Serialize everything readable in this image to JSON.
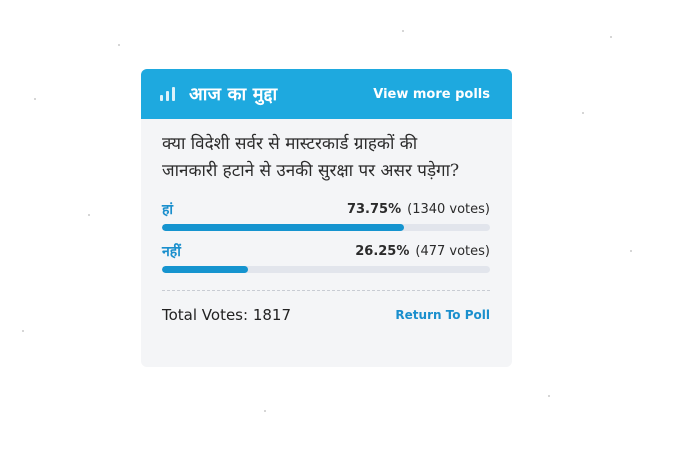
{
  "header": {
    "icon": "bar-chart-icon",
    "title": "आज का मुद्दा",
    "view_more_label": "View more polls"
  },
  "poll": {
    "question": "क्या विदेशी सर्वर से मास्टरकार्ड ग्राहकों की\nजानकारी हटाने से उनकी सुरक्षा पर असर पड़ेगा?",
    "options": [
      {
        "label": "हां",
        "percent_text": "73.75%",
        "votes_text": "(1340 votes)",
        "percent": 73.75
      },
      {
        "label": "नहीं",
        "percent_text": "26.25%",
        "votes_text": "(477 votes)",
        "percent": 26.25
      }
    ]
  },
  "footer": {
    "total_votes": "Total Votes: 1817",
    "return_label": "Return To Poll"
  },
  "colors": {
    "header_bg": "#1ea9df",
    "accent": "#1a8fcd",
    "bar_fill": "#1594cf",
    "bar_track": "#e2e5ec",
    "card_bg": "#f4f5f7"
  }
}
